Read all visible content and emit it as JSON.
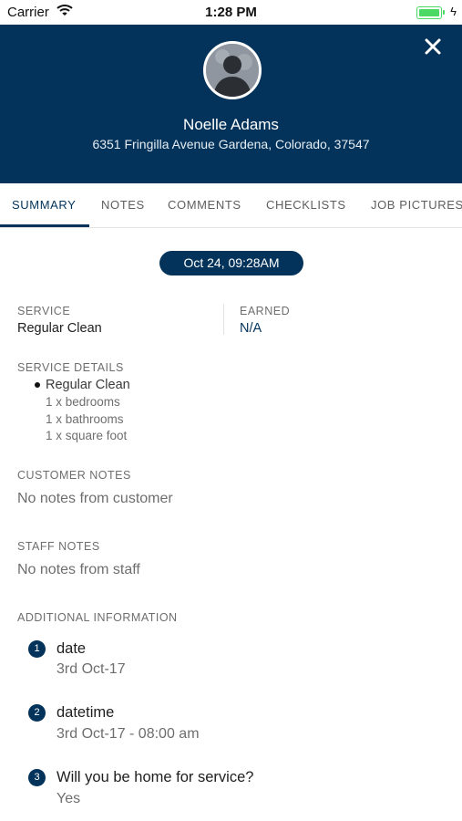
{
  "status_bar": {
    "carrier": "Carrier",
    "time": "1:28 PM"
  },
  "header": {
    "name": "Noelle Adams",
    "address": "6351 Fringilla Avenue Gardena, Colorado, 37547"
  },
  "tabs": [
    {
      "label": "SUMMARY"
    },
    {
      "label": "NOTES"
    },
    {
      "label": "COMMENTS"
    },
    {
      "label": "CHECKLISTS"
    },
    {
      "label": "JOB PICTURES"
    }
  ],
  "date_pill": "Oct 24, 09:28AM",
  "service": {
    "label": "SERVICE",
    "value": "Regular Clean"
  },
  "earned": {
    "label": "EARNED",
    "value": "N/A"
  },
  "service_details": {
    "label": "SERVICE DETAILS",
    "main": "Regular Clean",
    "items": [
      "1 x bedrooms",
      "1 x bathrooms",
      "1 x square foot"
    ]
  },
  "customer_notes": {
    "label": "CUSTOMER NOTES",
    "text": "No notes from customer"
  },
  "staff_notes": {
    "label": "STAFF NOTES",
    "text": "No notes from staff"
  },
  "additional_info": {
    "label": "ADDITIONAL INFORMATION",
    "items": [
      {
        "number": "1",
        "title": "date",
        "answer": "3rd Oct-17"
      },
      {
        "number": "2",
        "title": "datetime",
        "answer": "3rd Oct-17 - 08:00 am"
      },
      {
        "number": "3",
        "title": "Will you be home for service?",
        "answer": "Yes"
      }
    ]
  },
  "colors": {
    "primary": "#03335a",
    "battery": "#4cd964",
    "muted_text": "#6e6e6e"
  },
  "icons": {
    "close": "close-icon",
    "avatar": "avatar-placeholder-icon",
    "wifi": "wifi-icon",
    "battery": "battery-icon"
  }
}
